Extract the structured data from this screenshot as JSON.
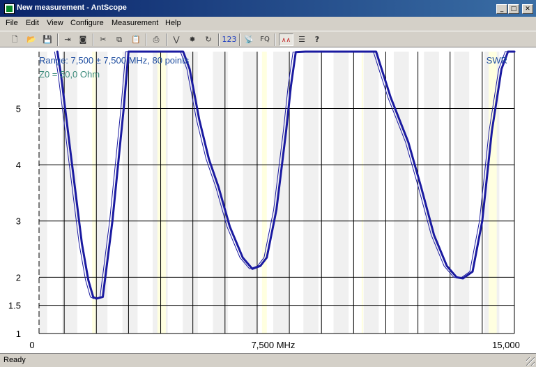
{
  "window": {
    "title": "New measurement - AntScope",
    "minimize_glyph": "_",
    "maximize_glyph": "□",
    "close_glyph": "✕"
  },
  "menu": [
    {
      "label": "File"
    },
    {
      "label": "Edit"
    },
    {
      "label": "View"
    },
    {
      "label": "Configure"
    },
    {
      "label": "Measurement"
    },
    {
      "label": "Help"
    }
  ],
  "toolbar": [
    {
      "icon": "new-file-icon",
      "glyph": "🗋"
    },
    {
      "icon": "open-folder-icon",
      "glyph": "📂"
    },
    {
      "icon": "save-icon",
      "glyph": "💾"
    },
    {
      "icon": "export-icon",
      "glyph": "⇥"
    },
    {
      "icon": "camera-icon",
      "glyph": "◙"
    },
    {
      "icon": "cut-icon",
      "glyph": "✂"
    },
    {
      "icon": "copy-icon",
      "glyph": "⧉"
    },
    {
      "icon": "paste-icon",
      "glyph": "📋"
    },
    {
      "icon": "print-icon",
      "glyph": "⎙"
    },
    {
      "icon": "chart-line-icon",
      "glyph": "⋁"
    },
    {
      "icon": "star-burst-icon",
      "glyph": "✸"
    },
    {
      "icon": "refresh-icon",
      "glyph": "↻"
    },
    {
      "icon": "numbers-icon",
      "label": "123"
    },
    {
      "icon": "antenna-icon",
      "glyph": "📡"
    },
    {
      "icon": "fq-icon",
      "label": "FQ"
    },
    {
      "icon": "graph-view-icon",
      "glyph": "∧∧"
    },
    {
      "icon": "list-view-icon",
      "glyph": "☰"
    },
    {
      "icon": "help-icon",
      "glyph": "?"
    }
  ],
  "status": {
    "text": "Ready"
  },
  "chart_data": {
    "type": "line",
    "annotations": {
      "range": "Range: 7,500 ± 7,500 MHz, 80 points",
      "z0": "Z0 = 50,0 Ohm",
      "series_label": "SWR"
    },
    "x_ticks": [
      {
        "value": 0,
        "label": "0"
      },
      {
        "value": 7500,
        "label": "7,500 MHz"
      },
      {
        "value": 15000,
        "label": "15,000"
      }
    ],
    "y_ticks": [
      {
        "value": 1,
        "label": "1"
      },
      {
        "value": 1.5,
        "label": "1.5"
      },
      {
        "value": 2,
        "label": "2"
      },
      {
        "value": 3,
        "label": "3"
      },
      {
        "value": 4,
        "label": "4"
      },
      {
        "value": 5,
        "label": "5"
      }
    ],
    "xlim": [
      0,
      15000
    ],
    "ylim": [
      1,
      6.01
    ],
    "grid": true,
    "colors": {
      "line": "#1a1aa0",
      "grid": "#000000",
      "shade": "#f0f0f0",
      "band": "#ffffe0",
      "text": "#1f4ea0"
    },
    "series": [
      {
        "values": [
          [
            787,
            6.01
          ],
          [
            900,
            5.6
          ],
          [
            1200,
            4.2
          ],
          [
            1550,
            2.6
          ],
          [
            1750,
            1.95
          ],
          [
            1900,
            1.65
          ],
          [
            2000,
            1.62
          ],
          [
            2200,
            1.65
          ],
          [
            2500,
            3.0
          ],
          [
            2850,
            5.0
          ],
          [
            3000,
            6.01
          ],
          [
            4500,
            6.01
          ],
          [
            4700,
            6.01
          ],
          [
            4900,
            5.7
          ],
          [
            5200,
            4.8
          ],
          [
            5500,
            4.1
          ],
          [
            5800,
            3.6
          ],
          [
            6150,
            2.9
          ],
          [
            6550,
            2.35
          ],
          [
            6850,
            2.15
          ],
          [
            7100,
            2.2
          ],
          [
            7300,
            2.35
          ],
          [
            7600,
            3.2
          ],
          [
            7900,
            4.6
          ],
          [
            8050,
            5.4
          ],
          [
            8200,
            6.0
          ],
          [
            8500,
            6.01
          ],
          [
            10700,
            6.01
          ],
          [
            11150,
            5.2
          ],
          [
            11700,
            4.4
          ],
          [
            12100,
            3.6
          ],
          [
            12500,
            2.75
          ],
          [
            12900,
            2.2
          ],
          [
            13200,
            2.0
          ],
          [
            13400,
            1.98
          ],
          [
            13700,
            2.1
          ],
          [
            14000,
            3.0
          ],
          [
            14300,
            4.6
          ],
          [
            14600,
            5.7
          ],
          [
            14800,
            6.01
          ],
          [
            15000,
            6.01
          ]
        ]
      }
    ]
  }
}
